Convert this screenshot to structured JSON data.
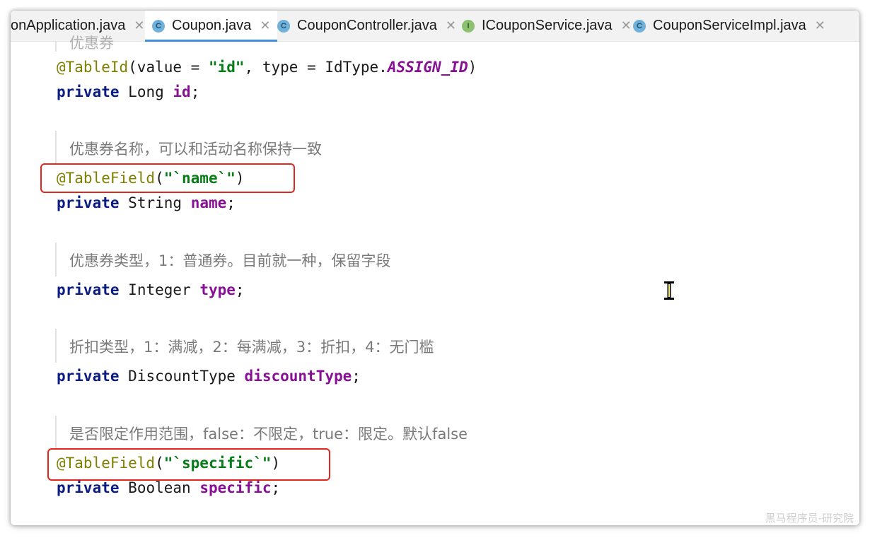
{
  "tabs": [
    {
      "label": "onApplication.java",
      "icon": "none",
      "active": false
    },
    {
      "label": "Coupon.java",
      "icon": "class-icon",
      "icon_letter": "C",
      "active": true
    },
    {
      "label": "CouponController.java",
      "icon": "class-icon",
      "icon_letter": "C",
      "active": false
    },
    {
      "label": "ICouponService.java",
      "icon": "interface-icon",
      "icon_letter": "I",
      "active": false
    },
    {
      "label": "CouponServiceImpl.java",
      "icon": "class-icon",
      "icon_letter": "C",
      "active": false
    }
  ],
  "tab_close_glyph": "✕",
  "doc_fragment": "优惠券",
  "code": {
    "id_annotation": "@TableId",
    "id_open": "(value = ",
    "id_value": "\"id\"",
    "id_mid": ", type = IdType.",
    "id_const": "ASSIGN_ID",
    "id_close": ")",
    "private": "private",
    "type_long": "Long",
    "field_id": "id",
    "semi": ";",
    "doc_name": "优惠券名称，可以和活动名称保持一致",
    "tablefield": "@TableField",
    "paren_open": "(",
    "paren_close": ")",
    "name_value": "\"`name`\"",
    "type_string": "String",
    "field_name": "name",
    "doc_type": "优惠券类型，1：普通券。目前就一种，保留字段",
    "type_integer": "Integer",
    "field_type": "type",
    "doc_discount": "折扣类型，1：满减，2：每满减，3：折扣，4：无门槛",
    "type_discount": "DiscountType",
    "field_discount": "discountType",
    "doc_specific": "是否限定作用范围，false：不限定，true：限定。默认false",
    "specific_value": "\"`specific`\"",
    "type_boolean": "Boolean",
    "field_specific": "specific"
  },
  "colors": {
    "keyword": "#0b1c84",
    "annotation": "#7f7f00",
    "string": "#067d17",
    "field": "#871094",
    "highlight_box": "#e1261c",
    "active_tab_underline": "#3d8fd8"
  },
  "watermark": "黑马程序员-研究院"
}
